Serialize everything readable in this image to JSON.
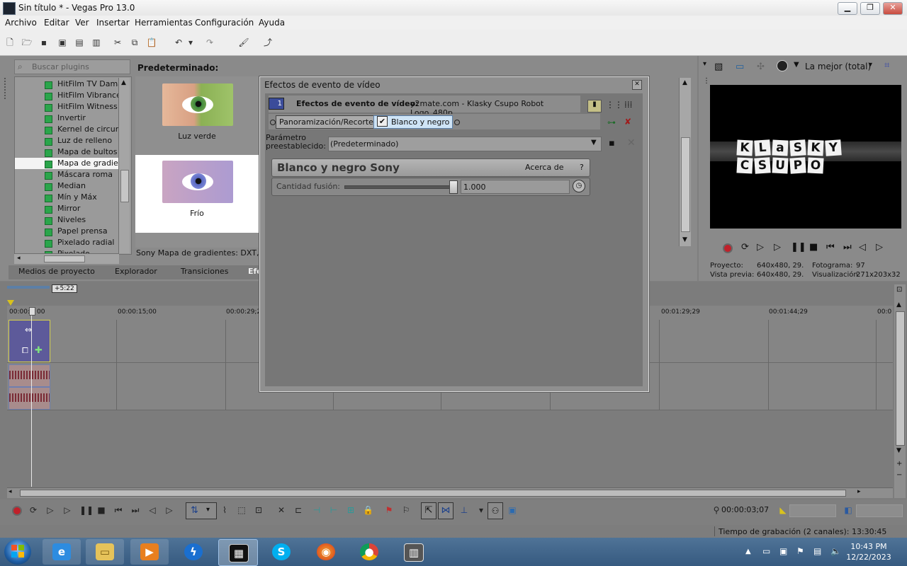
{
  "window": {
    "title": "Sin título * - Vegas Pro 13.0",
    "btn_min": "▁",
    "btn_max": "❐",
    "btn_close": "✕"
  },
  "menu": [
    "Archivo",
    "Editar",
    "Ver",
    "Insertar",
    "Herramientas",
    "Configuración",
    "Ayuda"
  ],
  "plugins": {
    "search_placeholder": "Buscar plugins",
    "items": [
      "HitFilm TV Damage",
      "HitFilm Vibrance",
      "HitFilm Witness Pr",
      "Invertir",
      "Kernel de circunvo",
      "Luz de relleno",
      "Mapa de bultos",
      "Mapa de gradient",
      "Máscara roma",
      "Median",
      "Mín y Máx",
      "Mirror",
      "Niveles",
      "Papel prensa",
      "Pixelado radial",
      "Pixelado"
    ],
    "selected_index": 7
  },
  "presets": {
    "header": "Predeterminado:",
    "items": [
      {
        "label": "Luz verde"
      },
      {
        "label": "Frío"
      }
    ],
    "description": "Sony Mapa de gradientes: DXT, Pun"
  },
  "tabs": [
    "Medios de proyecto",
    "Explorador",
    "Transiciones",
    "Efe"
  ],
  "dialog": {
    "title": "Efectos de evento de vídeo",
    "close": "✕",
    "badge": "1",
    "fx_label": "Efectos de evento de vídeo:",
    "fx_source": "y2mate.com - Klasky Csupo Robot Logo_480p",
    "chain": [
      "Panoramización/Recorte",
      "Blanco y negro"
    ],
    "preset_label_1": "Parámetro",
    "preset_label_2": "preestablecido:",
    "preset_value": "(Predeterminado)",
    "plugin_name": "Blanco y negro Sony",
    "about": "Acerca de",
    "help": "?",
    "param_label": "Cantidad fusión:",
    "param_value": "1.000",
    "param_level": 1.0
  },
  "preview": {
    "quality": "La mejor (total)",
    "logo_top": [
      "K",
      "L",
      "a",
      "S",
      "K",
      "Y"
    ],
    "logo_bottom": [
      "C",
      "S",
      "U",
      "P",
      "O"
    ],
    "proyecto_label": "Proyecto:",
    "proyecto_value": "640x480, 29.",
    "fotograma_label": "Fotograma:",
    "fotograma_value": "97",
    "vista_label": "Vista previa:",
    "vista_value": "640x480, 29.",
    "visual_label": "Visualización:",
    "visual_value": "271x203x32"
  },
  "timeline": {
    "offset_badge": "+5:22",
    "ticks": [
      "00:00:0",
      "00:00:15;00",
      "00:00:29;29",
      "00:01:29;29",
      "00:01:44;29",
      "00:0"
    ],
    "tick_first_tail": "00",
    "timecode": "00:00:03;07"
  },
  "status": {
    "rec_time": "Tiempo de grabación (2 canales): 13:30:45"
  },
  "taskbar": {
    "time": "10:43 PM",
    "date": "12/22/2023"
  }
}
